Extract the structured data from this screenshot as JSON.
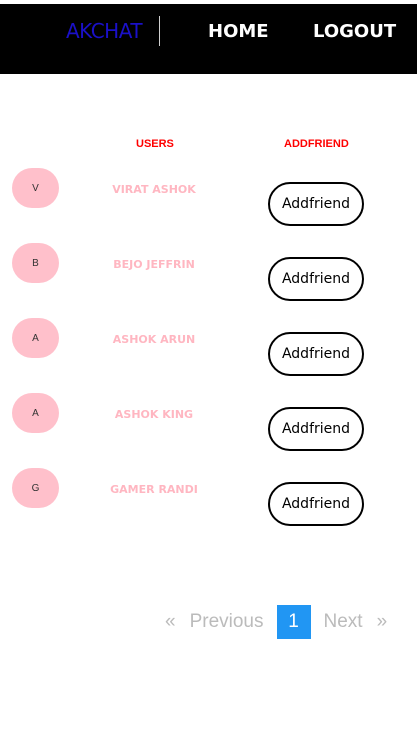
{
  "nav": {
    "brand": "AKCHAT",
    "home": "HOME",
    "logout": "LOGOUT"
  },
  "table": {
    "headers": {
      "users": "USERS",
      "addfriend": "ADDFRIEND"
    },
    "rows": [
      {
        "initial": "V",
        "name": "VIRAT ASHOK",
        "action": "Addfriend"
      },
      {
        "initial": "B",
        "name": "BEJO JEFFRIN",
        "action": "Addfriend"
      },
      {
        "initial": "A",
        "name": "ASHOK ARUN",
        "action": "Addfriend"
      },
      {
        "initial": "A",
        "name": "ASHOK KING",
        "action": "Addfriend"
      },
      {
        "initial": "G",
        "name": "GAMER RANDI",
        "action": "Addfriend"
      }
    ]
  },
  "pagination": {
    "prev_arrow": "«",
    "prev": "Previous",
    "current": "1",
    "next": "Next",
    "next_arrow": "»"
  }
}
